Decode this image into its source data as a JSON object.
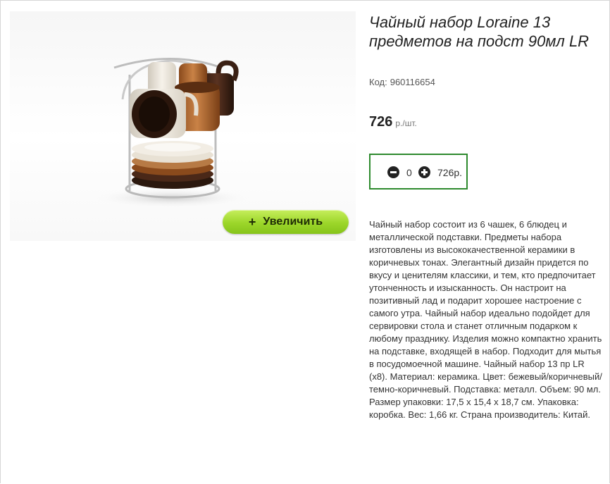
{
  "product": {
    "title": "Чайный набор Loraine 13 предметов на подст 90мл LR",
    "code_label": "Код:",
    "code": "960116654",
    "price": "726",
    "price_unit": "р./шт.",
    "zoom_button_icon": "+",
    "zoom_button_label": "Увеличить",
    "quantity": "0",
    "sum": "726р.",
    "description": "Чайный набор состоит из 6 чашек, 6 блюдец и металлической подставки. Предметы набора изготовлены из высококачественной керамики в коричневых тонах. Элегантный дизайн придется по вкусу и ценителям классики, и тем, кто предпочитает утонченность и изысканность. Он настроит на позитивный лад и подарит хорошее настроение с самого утра. Чайный набор идеально подойдет для сервировки стола и станет отличным подарком к любому празднику. Изделия можно компактно хранить на подставке, входящей в набор. Подходит для мытья в посудомоечной машине. Чайный набор 13 пр LR (x8). Материал: керамика. Цвет: бежевый/коричневый/темно-коричневый. Подставка: металл. Объем: 90 мл. Размер упаковки: 17,5 х 15,4 х 18,7 см. Упаковка: коробка. Вес: 1,66 кг. Страна производитель: Китай."
  },
  "icons": {
    "minus": "minus-circle-icon",
    "plus": "plus-circle-icon"
  },
  "colors": {
    "zoom_button": "#9cd62a",
    "qty_border": "#2e8a2e"
  }
}
